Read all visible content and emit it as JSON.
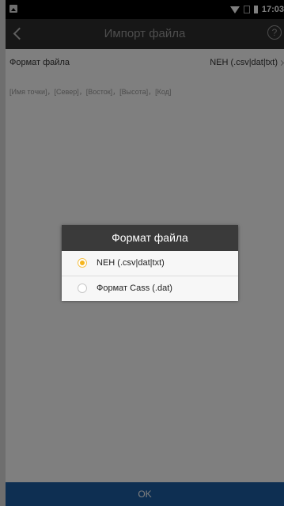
{
  "status_bar": {
    "time": "17:03",
    "icons": [
      "gallery-icon",
      "wifi-icon",
      "no-sim-icon",
      "battery-icon"
    ]
  },
  "title_bar": {
    "title": "Импорт файла",
    "back_icon": "chevron-left-icon",
    "help_icon": "help-icon",
    "help_glyph": "?"
  },
  "form": {
    "file_format_label": "Формат файла",
    "file_format_value": "NEH (.csv|dat|txt)",
    "columns_hint": "[Имя точки]，[Север]，[Восток]，[Высота]，[Код]"
  },
  "dialog": {
    "title": "Формат файла",
    "options": [
      {
        "label": "NEH (.csv|dat|txt)",
        "selected": true
      },
      {
        "label": "Формат Cass (.dat)",
        "selected": false
      }
    ]
  },
  "footer": {
    "ok_label": "OK"
  },
  "colors": {
    "title_bar_bg": "#2e2e2e",
    "accent_radio": "#f5b51e",
    "ok_button_bg": "#1d5fa5"
  }
}
